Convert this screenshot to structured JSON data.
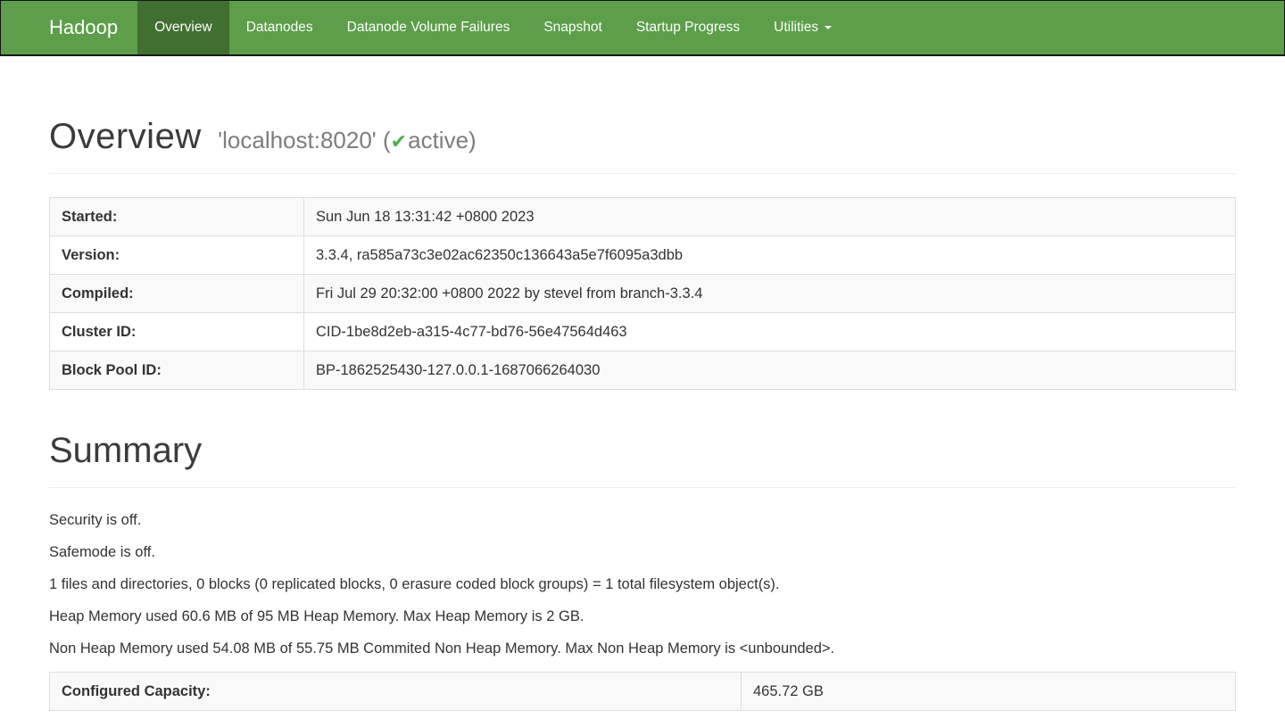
{
  "navbar": {
    "brand": "Hadoop",
    "items": [
      {
        "label": "Overview",
        "active": true
      },
      {
        "label": "Datanodes",
        "active": false
      },
      {
        "label": "Datanode Volume Failures",
        "active": false
      },
      {
        "label": "Snapshot",
        "active": false
      },
      {
        "label": "Startup Progress",
        "active": false
      },
      {
        "label": "Utilities",
        "active": false,
        "has_dropdown": true
      }
    ]
  },
  "header": {
    "title": "Overview",
    "host": "'localhost:8020'",
    "paren_open": "(",
    "check_icon": "✔",
    "state": "active",
    "paren_close": ")"
  },
  "overview_table": {
    "rows": [
      {
        "label": "Started:",
        "value": "Sun Jun 18 13:31:42 +0800 2023"
      },
      {
        "label": "Version:",
        "value": "3.3.4, ra585a73c3e02ac62350c136643a5e7f6095a3dbb"
      },
      {
        "label": "Compiled:",
        "value": "Fri Jul 29 20:32:00 +0800 2022 by stevel from branch-3.3.4"
      },
      {
        "label": "Cluster ID:",
        "value": "CID-1be8d2eb-a315-4c77-bd76-56e47564d463"
      },
      {
        "label": "Block Pool ID:",
        "value": "BP-1862525430-127.0.0.1-1687066264030"
      }
    ]
  },
  "summary": {
    "title": "Summary",
    "paragraphs": [
      "Security is off.",
      "Safemode is off.",
      "1 files and directories, 0 blocks (0 replicated blocks, 0 erasure coded block groups) = 1 total filesystem object(s).",
      "Heap Memory used 60.6 MB of 95 MB Heap Memory. Max Heap Memory is 2 GB.",
      "Non Heap Memory used 54.08 MB of 55.75 MB Commited Non Heap Memory. Max Non Heap Memory is <unbounded>."
    ]
  },
  "capacity_table": {
    "rows": [
      {
        "label": "Configured Capacity:",
        "value": "465.72 GB"
      }
    ]
  },
  "colors": {
    "navbar_green": "#5c9e49",
    "navbar_active_green": "#416f30",
    "navbar_border_dark": "#171717",
    "check_green": "#4cae4c",
    "table_border": "#dddddd",
    "table_stripe": "#f9f9f9",
    "text_dark": "#333333",
    "subtitle_gray": "#7d7d7d"
  }
}
